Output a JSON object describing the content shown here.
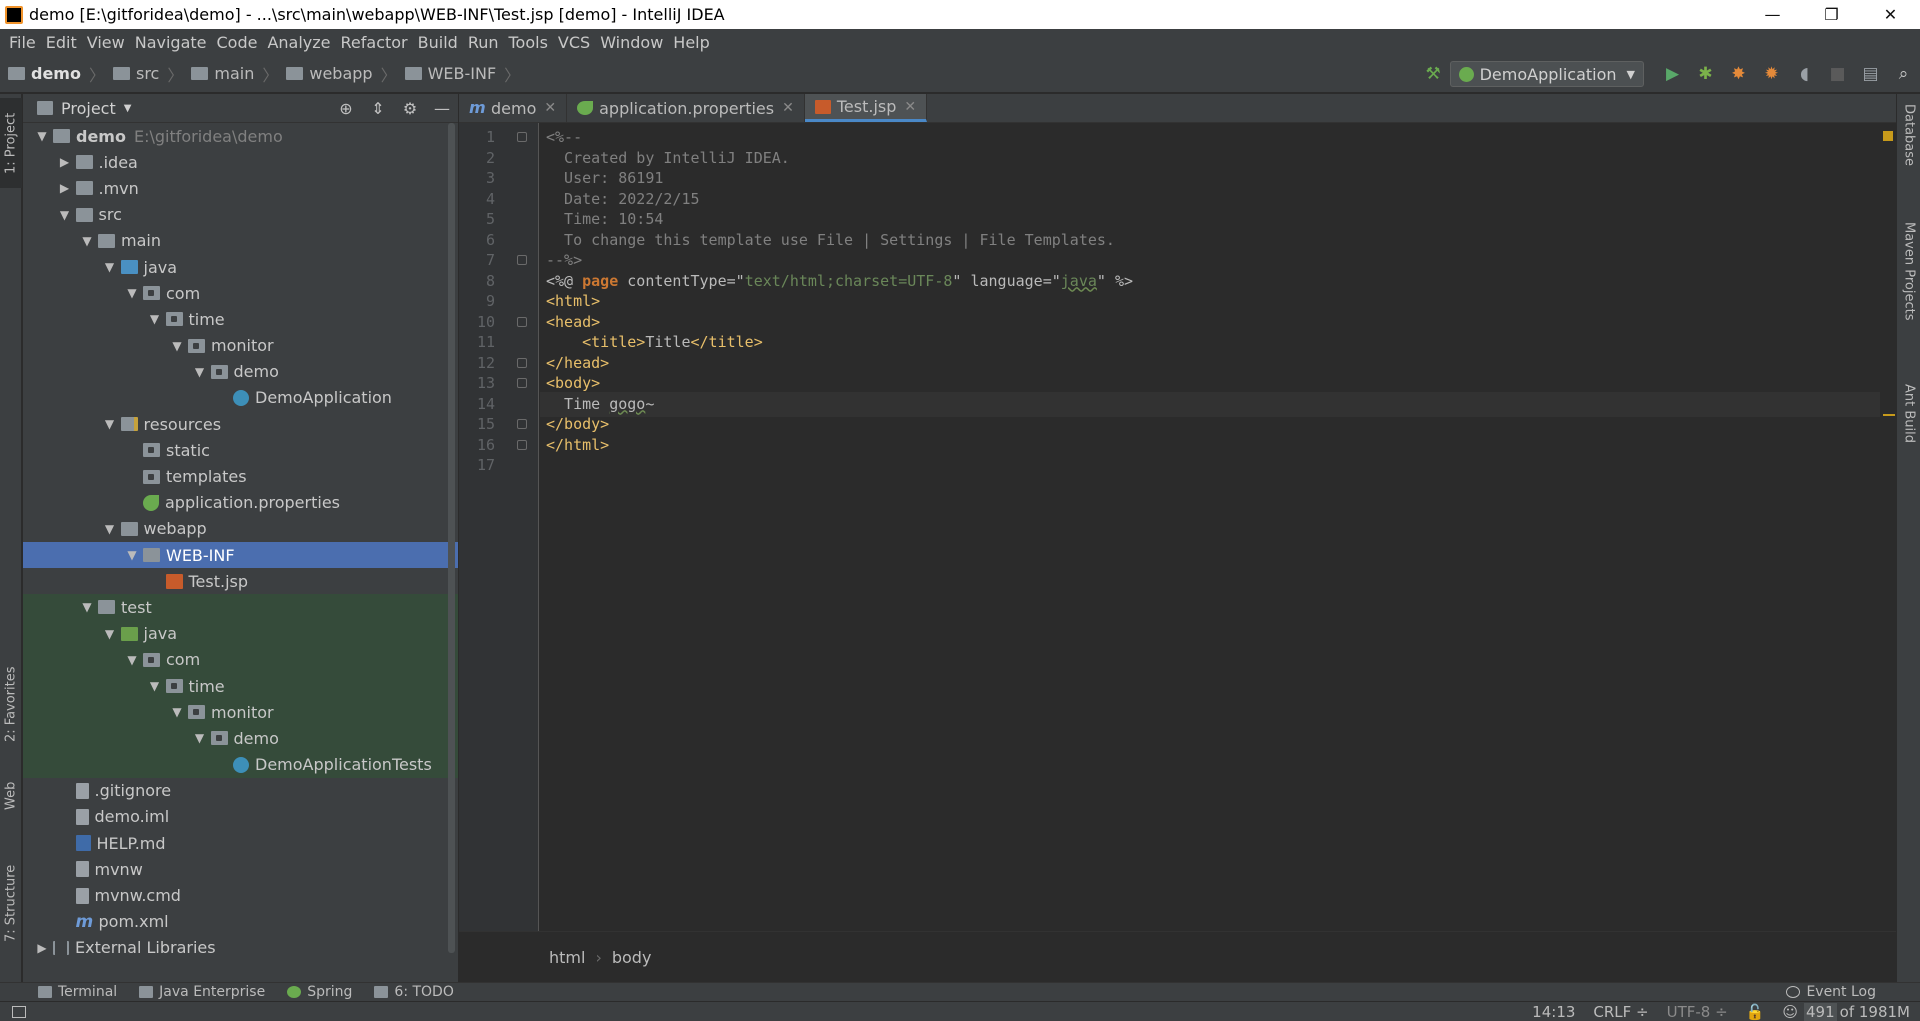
{
  "window": {
    "title": "demo [E:\\gitforidea\\demo] - ...\\src\\main\\webapp\\WEB-INF\\Test.jsp [demo] - IntelliJ IDEA",
    "minimize_glyph": "—",
    "maximize_glyph": "❐",
    "close_glyph": "✕"
  },
  "menu": [
    "File",
    "Edit",
    "View",
    "Navigate",
    "Code",
    "Analyze",
    "Refactor",
    "Build",
    "Run",
    "Tools",
    "VCS",
    "Window",
    "Help"
  ],
  "breadcrumbs": [
    "demo",
    "src",
    "main",
    "webapp",
    "WEB-INF"
  ],
  "run_config": {
    "label": "DemoApplication"
  },
  "left_tool_tabs": {
    "project": "1: Project",
    "favorites": "2: Favorites",
    "web": "Web",
    "structure": "7: Structure"
  },
  "right_tool_tabs": {
    "database": "Database",
    "maven": "Maven Projects",
    "ant": "Ant Build"
  },
  "project_panel": {
    "title": "Project"
  },
  "tree": [
    {
      "label": "demo",
      "extra": "E:\\gitforidea\\demo",
      "icon": "module-folder-icon",
      "arrow": "▼"
    },
    {
      "label": ".idea",
      "icon": "folder-icon",
      "arrow": "▶"
    },
    {
      "label": ".mvn",
      "icon": "folder-icon",
      "arrow": "▶"
    },
    {
      "label": "src",
      "icon": "folder-icon",
      "arrow": "▼"
    },
    {
      "label": "main",
      "icon": "folder-icon",
      "arrow": "▼"
    },
    {
      "label": "java",
      "icon": "source-folder-icon",
      "arrow": "▼"
    },
    {
      "label": "com",
      "icon": "package-icon",
      "arrow": "▼"
    },
    {
      "label": "time",
      "icon": "package-icon",
      "arrow": "▼"
    },
    {
      "label": "monitor",
      "icon": "package-icon",
      "arrow": "▼"
    },
    {
      "label": "demo",
      "icon": "package-icon",
      "arrow": "▼"
    },
    {
      "label": "DemoApplication",
      "icon": "spring-class-icon",
      "arrow": ""
    },
    {
      "label": "resources",
      "icon": "resources-folder-icon",
      "arrow": "▼"
    },
    {
      "label": "static",
      "icon": "package-icon",
      "arrow": ""
    },
    {
      "label": "templates",
      "icon": "package-icon",
      "arrow": ""
    },
    {
      "label": "application.properties",
      "icon": "spring-properties-icon",
      "arrow": ""
    },
    {
      "label": "webapp",
      "icon": "folder-icon",
      "arrow": "▼"
    },
    {
      "label": "WEB-INF",
      "icon": "folder-icon",
      "arrow": "▼"
    },
    {
      "label": "Test.jsp",
      "icon": "jsp-file-icon",
      "arrow": ""
    },
    {
      "label": "test",
      "icon": "folder-icon",
      "arrow": "▼"
    },
    {
      "label": "java",
      "icon": "test-folder-icon",
      "arrow": "▼"
    },
    {
      "label": "com",
      "icon": "package-icon",
      "arrow": "▼"
    },
    {
      "label": "time",
      "icon": "package-icon",
      "arrow": "▼"
    },
    {
      "label": "monitor",
      "icon": "package-icon",
      "arrow": "▼"
    },
    {
      "label": "demo",
      "icon": "package-icon",
      "arrow": "▼"
    },
    {
      "label": "DemoApplicationTests",
      "icon": "test-class-icon",
      "arrow": ""
    },
    {
      "label": ".gitignore",
      "icon": "file-icon",
      "arrow": ""
    },
    {
      "label": "demo.iml",
      "icon": "file-icon",
      "arrow": ""
    },
    {
      "label": "HELP.md",
      "icon": "markdown-file-icon",
      "arrow": ""
    },
    {
      "label": "mvnw",
      "icon": "file-icon",
      "arrow": ""
    },
    {
      "label": "mvnw.cmd",
      "icon": "file-icon",
      "arrow": ""
    },
    {
      "label": "pom.xml",
      "icon": "maven-file-icon",
      "arrow": ""
    },
    {
      "label": "External Libraries",
      "icon": "libraries-icon",
      "arrow": "▶"
    }
  ],
  "editor_tabs": [
    {
      "label": "demo",
      "icon": "maven-icon",
      "active": false
    },
    {
      "label": "application.properties",
      "icon": "spring-properties-icon",
      "active": false
    },
    {
      "label": "Test.jsp",
      "icon": "jsp-file-icon",
      "active": true
    }
  ],
  "code_lines": [
    [
      {
        "t": "<%--",
        "c": "cm"
      }
    ],
    [
      {
        "t": "  Created by IntelliJ IDEA.",
        "c": "cm"
      }
    ],
    [
      {
        "t": "  User: 86191",
        "c": "cm"
      }
    ],
    [
      {
        "t": "  Date: 2022/2/15",
        "c": "cm"
      }
    ],
    [
      {
        "t": "  Time: 10:54",
        "c": "cm"
      }
    ],
    [
      {
        "t": "  To change this template use File | Settings | File Templates.",
        "c": "cm"
      }
    ],
    [
      {
        "t": "--%>",
        "c": "cm"
      }
    ],
    [
      {
        "t": "<%@ ",
        "c": "pl"
      },
      {
        "t": "page",
        "c": "dir"
      },
      {
        "t": " contentType=\"",
        "c": "pl"
      },
      {
        "t": "text/html;charset=UTF-8",
        "c": "str"
      },
      {
        "t": "\" language=\"",
        "c": "pl"
      },
      {
        "t": "java",
        "c": "str wavy"
      },
      {
        "t": "\" %>",
        "c": "pl"
      }
    ],
    [
      {
        "t": "<html>",
        "c": "tag"
      }
    ],
    [
      {
        "t": "<head>",
        "c": "tag"
      }
    ],
    [
      {
        "t": "    ",
        "c": "pl"
      },
      {
        "t": "<title>",
        "c": "tag"
      },
      {
        "t": "Title",
        "c": "pl"
      },
      {
        "t": "</title>",
        "c": "tag"
      }
    ],
    [
      {
        "t": "</head>",
        "c": "tag"
      }
    ],
    [
      {
        "t": "<body>",
        "c": "tag"
      }
    ],
    [
      {
        "t": "  Time ",
        "c": "pl"
      },
      {
        "t": "gogo",
        "c": "pl wavy"
      },
      {
        "t": "~",
        "c": "pl"
      }
    ],
    [
      {
        "t": "</body>",
        "c": "tag"
      }
    ],
    [
      {
        "t": "</html>",
        "c": "tag"
      }
    ],
    []
  ],
  "editor_breadcrumbs": [
    "html",
    "body"
  ],
  "bottom_tools": [
    {
      "label": "Terminal",
      "icon": "terminal-icon"
    },
    {
      "label": "Java Enterprise",
      "icon": "java-enterprise-icon"
    },
    {
      "label": "Spring",
      "icon": "spring-icon"
    },
    {
      "label": "6: TODO",
      "icon": "todo-icon"
    }
  ],
  "event_log": "Event Log",
  "status": {
    "position": "14:13",
    "line_sep": "CRLF ÷",
    "encoding": "UTF-8 ÷",
    "memory_used": "491",
    "memory_total": "of 1981M"
  }
}
